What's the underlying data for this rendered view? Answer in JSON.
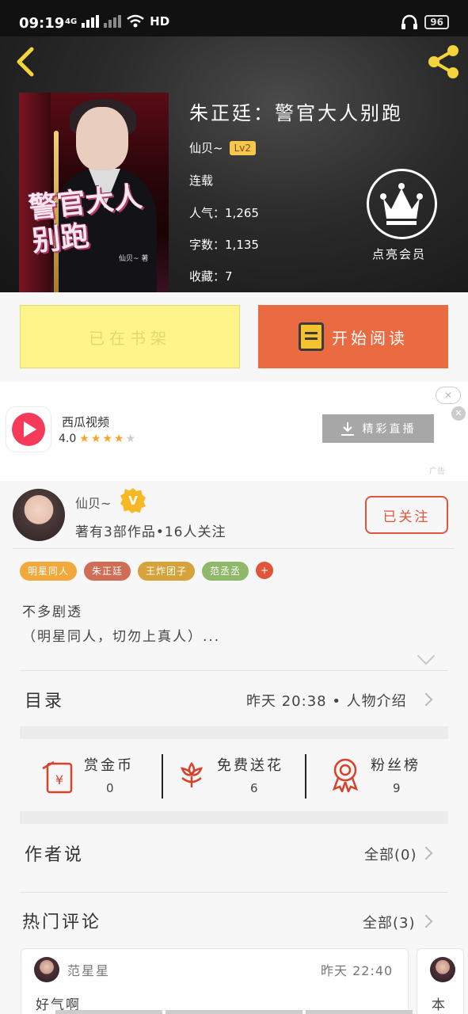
{
  "status_bar": {
    "time": "09:19",
    "signal": "4G",
    "network": "HD",
    "battery": "96"
  },
  "book": {
    "title": "朱正廷：警官大人别跑",
    "author": "仙贝~",
    "author_level": "Lv2",
    "status": "连载",
    "popularity_label": "人气：",
    "popularity": "1,265",
    "word_count_label": "字数：",
    "word_count": "1,135",
    "favorites_label": "收藏：",
    "favorites": "7",
    "vip_label": "点亮会员",
    "cover_title": "警官大人别跑",
    "cover_author": "仙贝~ 著"
  },
  "actions": {
    "shelf_label": "已在书架",
    "read_label": "开始阅读"
  },
  "ad": {
    "app_name": "西瓜视频",
    "rating": "4.0",
    "stars_filled": 4,
    "stars_total": 5,
    "button_label": "精彩直播",
    "close_label": "✕",
    "mark": "广告"
  },
  "author_card": {
    "name": "仙贝~",
    "badge": "V",
    "stats": "著有3部作品•16人关注",
    "follow_label": "已关注",
    "tags": [
      {
        "label": "明星同人",
        "color": "#f2a93b"
      },
      {
        "label": "朱正廷",
        "color": "#d06d56"
      },
      {
        "label": "王炸团子",
        "color": "#d6a23a"
      },
      {
        "label": "范丞丞",
        "color": "#8fb86a"
      }
    ],
    "tag_more": "+",
    "intro_line1": "不多剧透",
    "intro_line2": "（明星同人，切勿上真人）..."
  },
  "catalog": {
    "title": "目录",
    "latest": "昨天 20:38 • 人物介绍"
  },
  "stats": [
    {
      "label": "赏金币",
      "value": "0",
      "icon": "red-envelope-icon"
    },
    {
      "label": "免费送花",
      "value": "6",
      "icon": "flower-icon"
    },
    {
      "label": "粉丝榜",
      "value": "9",
      "icon": "medal-icon"
    }
  ],
  "author_says": {
    "title": "作者说",
    "all_label": "全部(0)"
  },
  "hot_comments": {
    "title": "热门评论",
    "all_label": "全部(3)",
    "items": [
      {
        "user": "范星星",
        "time": "昨天 22:40",
        "text": "好气啊"
      },
      {
        "user": "",
        "time": "",
        "text": "本"
      }
    ]
  }
}
